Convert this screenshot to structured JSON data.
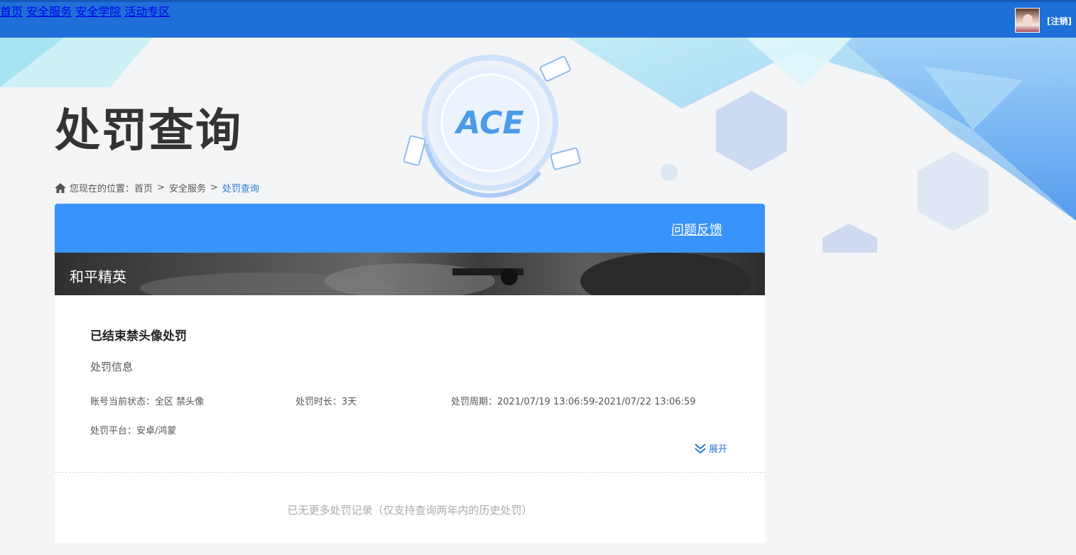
{
  "nav": {
    "items": [
      "首页",
      "安全服务",
      "安全学院",
      "活动专区"
    ],
    "logout_label": "[注销]"
  },
  "page": {
    "title": "处罚查询"
  },
  "breadcrumb": {
    "prefix": "您现在的位置：",
    "items": [
      "首页",
      "安全服务",
      "处罚查询"
    ],
    "separator": ">"
  },
  "card": {
    "feedback_label": "问题反馈",
    "game_name": "和平精英",
    "penalty_title": "已结束禁头像处罚",
    "info_label": "处罚信息",
    "status": "账号当前状态：全区 禁头像",
    "duration": "处罚时长：3天",
    "period": "处罚周期：2021/07/19 13:06:59-2021/07/22 13:06:59",
    "platform": "处罚平台：安卓/鸿蒙",
    "expand_label": "展开",
    "no_more": "已无更多处罚记录（仅支持查询两年内的历史处罚）"
  },
  "logo_text": "ACE",
  "colors": {
    "topbar": "#1e6fd8",
    "card_header": "#3894fb",
    "link": "#2a7ad5"
  }
}
